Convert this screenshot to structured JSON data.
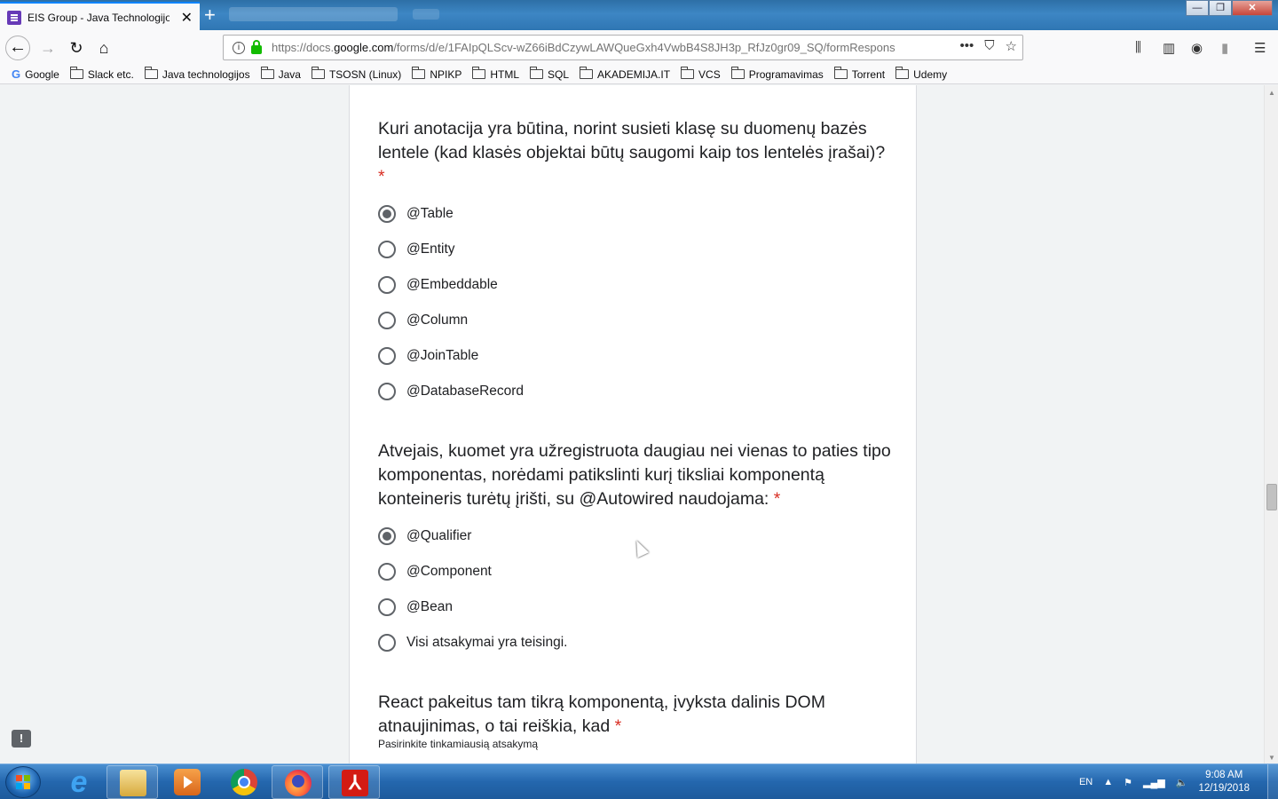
{
  "browser": {
    "tab_title": "EIS Group - Java Technologijos",
    "tab_close": "✕",
    "new_tab": "+",
    "window_controls": {
      "minimize": "—",
      "maximize": "❐",
      "close": "✕"
    },
    "nav": {
      "back": "←",
      "forward": "→",
      "reload": "↻",
      "home": "⌂"
    },
    "url_prefix": "https://docs.",
    "url_domain": "google.com",
    "url_path": "/forms/d/e/1FAIpQLScv-wZ66iBdCzywLAWQueGxh4VwbB4S8JH3p_RfJz0gr09_SQ/formRespons",
    "url_actions": {
      "more": "•••",
      "pocket": "⛉",
      "bookmark": "☆"
    },
    "toolbar_icons": {
      "library": "⫼",
      "sidebar": "▥",
      "extension": "◉",
      "extension2": "▮",
      "menu": "☰"
    },
    "bookmarks": [
      {
        "label": "Google",
        "type": "google"
      },
      {
        "label": "Slack etc.",
        "type": "folder"
      },
      {
        "label": "Java technologijos",
        "type": "folder"
      },
      {
        "label": "Java",
        "type": "folder"
      },
      {
        "label": "TSOSN (Linux)",
        "type": "folder"
      },
      {
        "label": "NPIKP",
        "type": "folder"
      },
      {
        "label": "HTML",
        "type": "folder"
      },
      {
        "label": "SQL",
        "type": "folder"
      },
      {
        "label": "AKADEMIJA.IT",
        "type": "folder"
      },
      {
        "label": "VCS",
        "type": "folder"
      },
      {
        "label": "Programavimas",
        "type": "folder"
      },
      {
        "label": "Torrent",
        "type": "folder"
      },
      {
        "label": "Udemy",
        "type": "folder"
      }
    ]
  },
  "form": {
    "questions": [
      {
        "title": "Kuri anotacija yra būtina, norint susieti klasę su duomenų bazės lentele (kad klasės objektai būtų saugomi kaip tos lentelės įrašai)?",
        "required_mark": "*",
        "options": [
          {
            "label": "@Table",
            "checked": true
          },
          {
            "label": "@Entity",
            "checked": false
          },
          {
            "label": "@Embeddable",
            "checked": false
          },
          {
            "label": "@Column",
            "checked": false
          },
          {
            "label": "@JoinTable",
            "checked": false
          },
          {
            "label": "@DatabaseRecord",
            "checked": false
          }
        ]
      },
      {
        "title": "Atvejais, kuomet yra užregistruota daugiau nei vienas to paties tipo komponentas, norėdami patikslinti kurį tiksliai komponentą konteineris turėtų įrišti, su @Autowired naudojama:",
        "required_mark": "*",
        "options": [
          {
            "label": "@Qualifier",
            "checked": true
          },
          {
            "label": "@Component",
            "checked": false
          },
          {
            "label": "@Bean",
            "checked": false
          },
          {
            "label": "Visi atsakymai yra teisingi.",
            "checked": false
          }
        ]
      },
      {
        "title": "React pakeitus tam tikrą komponentą, įvyksta dalinis DOM atnaujinimas, o tai reiškia, kad",
        "required_mark": "*",
        "help_text": "Pasirinkite tinkamiausią atsakymą"
      }
    ],
    "feedback_icon": "!"
  },
  "taskbar": {
    "apps": [
      "start",
      "internet-explorer",
      "file-explorer",
      "media-player",
      "chrome",
      "firefox",
      "acrobat"
    ],
    "acrobat_glyph": "⅄",
    "ie_glyph": "e",
    "language": "EN",
    "tray_arrow": "▲",
    "time": "9:08 AM",
    "date": "12/19/2018"
  }
}
